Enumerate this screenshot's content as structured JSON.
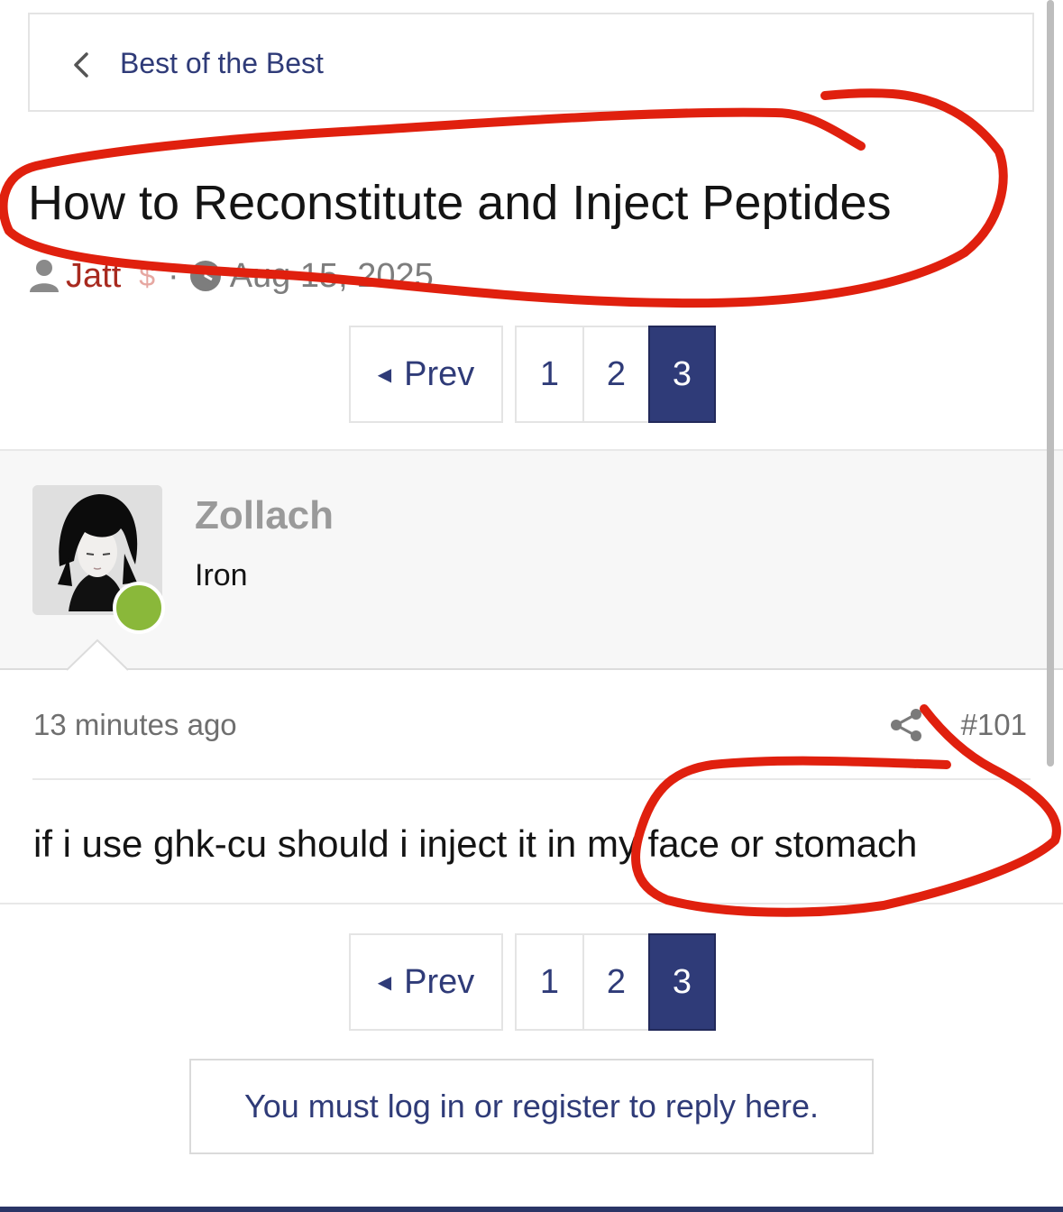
{
  "breadcrumb": {
    "label": "Best of the Best",
    "icon": "chevron-left-icon"
  },
  "thread": {
    "title": "How to Reconstitute and Inject Peptides",
    "author": "Jatt",
    "separator": "·",
    "date": "Aug 15, 2025"
  },
  "pagination": {
    "prev_label": "Prev",
    "pages": [
      "1",
      "2",
      "3"
    ],
    "current": "3"
  },
  "post": {
    "username": "Zollach",
    "user_title": "Iron",
    "online": true,
    "time": "13 minutes ago",
    "number": "#101",
    "body": "if i use ghk-cu should i inject it in my face or stomach"
  },
  "reply_notice": "You must log in or register to reply here.",
  "colors": {
    "link": "#2f3b78",
    "author": "#a82a1f",
    "annotation": "#e0200e",
    "online": "#8ab83a"
  }
}
